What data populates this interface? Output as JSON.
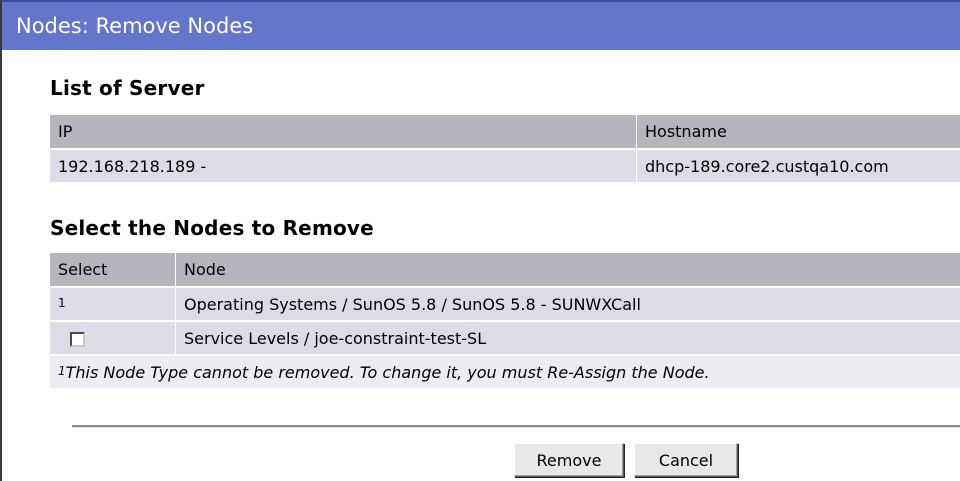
{
  "window": {
    "title": "Nodes: Remove Nodes"
  },
  "server_list": {
    "heading": "List of Server",
    "columns": [
      "IP",
      "Hostname"
    ],
    "rows": [
      {
        "ip": "192.168.218.189 -",
        "hostname": "dhcp-189.core2.custqa10.com"
      }
    ]
  },
  "nodes": {
    "heading": "Select the Nodes to Remove",
    "columns": [
      "Select",
      "Node"
    ],
    "rows": [
      {
        "select_marker": "1",
        "select_type": "footnote",
        "node": "Operating Systems / SunOS 5.8 / SunOS 5.8 - SUNWXCall"
      },
      {
        "select_marker": "",
        "select_type": "checkbox",
        "checked": false,
        "node": "Service Levels / joe-constraint-test-SL"
      }
    ],
    "footnote_marker": "1",
    "footnote_text": "This Node Type cannot be removed. To change it, you must Re-Assign the Node."
  },
  "actions": {
    "remove_label": "Remove",
    "cancel_label": "Cancel"
  },
  "colors": {
    "titlebar": "#6675cc",
    "table_header": "#b5b5bd",
    "table_row": "#dcdce6"
  }
}
